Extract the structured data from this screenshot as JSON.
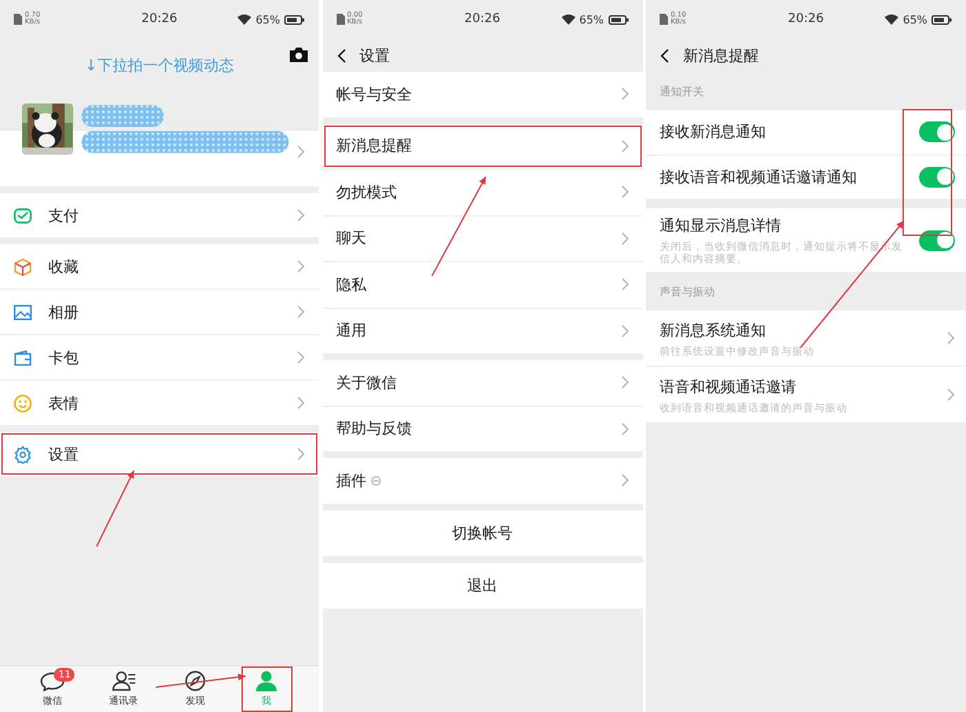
{
  "me_page": {
    "status_bar": {
      "speed": "0.70",
      "speed_unit": "KB/s",
      "time": "20:26",
      "battery": "65%"
    },
    "pull_hint": "↓下拉拍一个视频动态",
    "menu_groups": [
      [
        {
          "label": "支付",
          "highlighted": false
        }
      ],
      [
        {
          "label": "收藏",
          "highlighted": false
        },
        {
          "label": "相册",
          "highlighted": false
        },
        {
          "label": "卡包",
          "highlighted": false
        },
        {
          "label": "表情",
          "highlighted": false
        }
      ],
      [
        {
          "label": "设置",
          "highlighted": true
        }
      ]
    ],
    "tab_bar": [
      {
        "label": "微信",
        "badge": "11",
        "selected": false,
        "highlighted": false
      },
      {
        "label": "通讯录",
        "selected": false,
        "highlighted": false
      },
      {
        "label": "发现",
        "selected": false,
        "highlighted": false
      },
      {
        "label": "我",
        "selected": true,
        "highlighted": true
      }
    ]
  },
  "settings_page": {
    "status_bar": {
      "speed": "0.00",
      "speed_unit": "KB/s",
      "time": "20:26",
      "battery": "65%"
    },
    "title": "设置",
    "groups": [
      [
        {
          "label": "帐号与安全",
          "highlighted": false,
          "indicator": false
        }
      ],
      [
        {
          "label": "新消息提醒",
          "highlighted": true,
          "indicator": false
        },
        {
          "label": "勿扰模式",
          "highlighted": false,
          "indicator": false
        },
        {
          "label": "聊天",
          "highlighted": false,
          "indicator": false
        },
        {
          "label": "隐私",
          "highlighted": false,
          "indicator": false
        },
        {
          "label": "通用",
          "highlighted": false,
          "indicator": false
        }
      ],
      [
        {
          "label": "关于微信",
          "highlighted": false,
          "indicator": false
        },
        {
          "label": "帮助与反馈",
          "highlighted": false,
          "indicator": false
        }
      ],
      [
        {
          "label": "插件",
          "highlighted": false,
          "indicator": true
        }
      ]
    ],
    "buttons": [
      {
        "label": "切换帐号"
      },
      {
        "label": "退出"
      }
    ]
  },
  "notify_page": {
    "status_bar": {
      "speed": "0.10",
      "speed_unit": "KB/s",
      "time": "20:26",
      "battery": "65%"
    },
    "title": "新消息提醒",
    "toggles_highlighted": true,
    "sections": [
      {
        "header": "通知开关",
        "groups": [
          [
            {
              "kind": "toggle",
              "label": "接收新消息通知",
              "on": true
            },
            {
              "kind": "toggle",
              "label": "接收语音和视频通话邀请通知",
              "on": true
            }
          ],
          [
            {
              "kind": "toggle",
              "label": "通知显示消息详情",
              "on": true,
              "description": "关闭后，当收到微信消息时，通知提示将不显示发信人和内容摘要。"
            }
          ]
        ]
      },
      {
        "header": "声音与振动",
        "groups": [
          [
            {
              "kind": "link",
              "label": "新消息系统通知",
              "description": "前往系统设置中修改声音与振动"
            },
            {
              "kind": "link",
              "label": "语音和视频通话邀请",
              "description": "收到语音和视频通话邀请的声音与振动"
            }
          ]
        ]
      }
    ]
  }
}
